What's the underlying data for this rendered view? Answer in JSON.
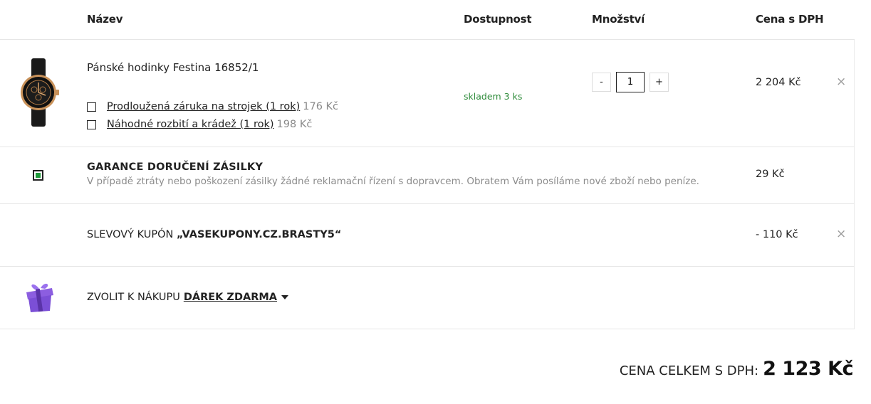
{
  "header": {
    "name": "Název",
    "availability": "Dostupnost",
    "quantity": "Množství",
    "price": "Cena s DPH"
  },
  "product": {
    "name": "Pánské hodinky Festina 16852/1",
    "image_icon": "wristwatch-icon",
    "addons": [
      {
        "label": "Prodloužená záruka na strojek (1 rok)",
        "price": "176 Kč"
      },
      {
        "label": "Náhodné rozbití a krádež (1 rok)",
        "price": "198 Kč"
      }
    ],
    "stock": "skladem 3 ks",
    "qty_minus": "-",
    "qty_value": "1",
    "qty_plus": "+",
    "price": "2 204 Kč",
    "remove": "×"
  },
  "guarantee": {
    "title": "GARANCE DORUČENÍ ZÁSILKY",
    "description": "V případě ztráty nebo poškození zásilky žádné reklamační řízení s dopravcem. Obratem Vám posíláme nové zboží nebo peníze.",
    "price": "29 Kč"
  },
  "coupon": {
    "prefix": "SLEVOVÝ KUPÓN",
    "code": "„VASEKUPONY.CZ.BRASTY5“",
    "price": "- 110 Kč",
    "remove": "×"
  },
  "gift": {
    "prefix": "ZVOLIT K NÁKUPU",
    "link": "DÁREK ZDARMA",
    "icon": "gift-icon",
    "icon_color": "#7b4fd6"
  },
  "total": {
    "label": "CENA CELKEM S DPH:",
    "value": "2 123 Kč"
  },
  "colors": {
    "stock_green": "#2e8b3a",
    "muted_gray": "#8c8c8c",
    "guarantee_check": "#1e9a3a"
  }
}
